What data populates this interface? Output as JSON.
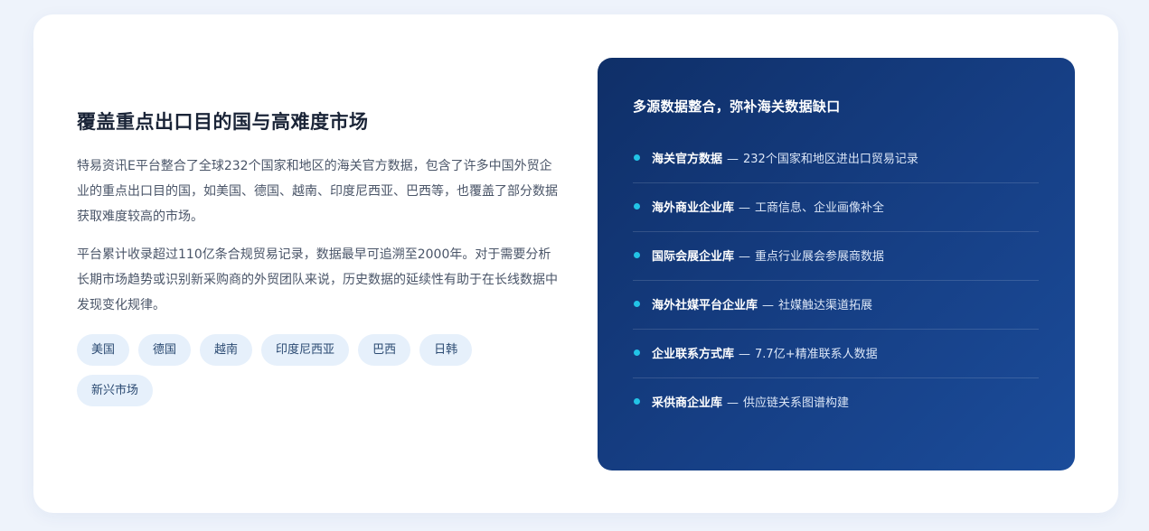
{
  "left": {
    "title": "覆盖重点出口目的国与高难度市场",
    "paragraphs": [
      "特易资讯E平台整合了全球232个国家和地区的海关官方数据，包含了许多中国外贸企业的重点出口目的国，如美国、德国、越南、印度尼西亚、巴西等，也覆盖了部分数据获取难度较高的市场。",
      "平台累计收录超过110亿条合规贸易记录，数据最早可追溯至2000年。对于需要分析长期市场趋势或识别新采购商的外贸团队来说，历史数据的延续性有助于在长线数据中发现变化规律。"
    ],
    "tags": [
      "美国",
      "德国",
      "越南",
      "印度尼西亚",
      "巴西",
      "日韩",
      "新兴市场"
    ]
  },
  "panel": {
    "title": "多源数据整合，弥补海关数据缺口",
    "separator": "—",
    "items": [
      {
        "name": "海关官方数据",
        "desc": "232个国家和地区进出口贸易记录"
      },
      {
        "name": "海外商业企业库",
        "desc": "工商信息、企业画像补全"
      },
      {
        "name": "国际会展企业库",
        "desc": "重点行业展会参展商数据"
      },
      {
        "name": "海外社媒平台企业库",
        "desc": "社媒触达渠道拓展"
      },
      {
        "name": "企业联系方式库",
        "desc": "7.7亿+精准联系人数据"
      },
      {
        "name": "采供商企业库",
        "desc": "供应链关系图谱构建"
      }
    ],
    "colors": {
      "accent_dot": "#22c3e6",
      "panel_start": "#0f2f68",
      "panel_end": "#1b4c9a"
    }
  }
}
